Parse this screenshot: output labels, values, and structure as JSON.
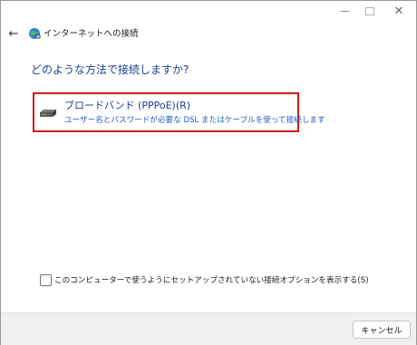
{
  "window": {
    "title": "インターネットへの接続",
    "controls": {
      "minimize": "minimize",
      "maximize": "maximize",
      "close": "✕"
    },
    "back_label": "←"
  },
  "main": {
    "heading": "どのような方法で接続しますか?",
    "options": [
      {
        "title": "ブロードバンド (PPPoE)(R)",
        "description": "ユーザー名とパスワードが必要な DSL またはケーブルを使って接続します",
        "icon": "modem-icon"
      }
    ],
    "checkbox": {
      "label": "このコンピューターで使うようにセットアップされていない接続オプションを表示する(S)",
      "checked": false
    }
  },
  "footer": {
    "cancel_label": "キャンセル"
  },
  "colors": {
    "heading": "#1b3f8f",
    "link": "#1f5fbf",
    "highlight": "#d11b1b"
  }
}
